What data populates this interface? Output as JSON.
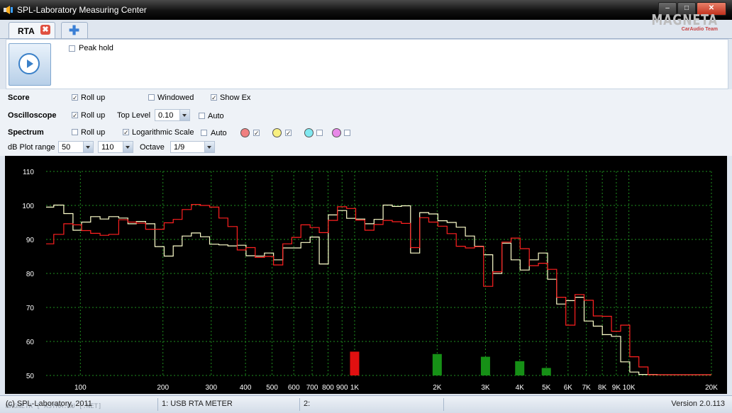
{
  "window": {
    "title": "SPL-Laboratory Measuring Center"
  },
  "logo": {
    "brand": "MAGNETA",
    "sub": "CarAudio Team"
  },
  "tabs": [
    {
      "label": "RTA",
      "close_icon": "close-icon"
    },
    {
      "add_icon": "plus-icon"
    }
  ],
  "panel": {
    "peak_hold_label": "Peak hold",
    "peak_hold_checked": false
  },
  "score": {
    "label": "Score",
    "rollup_label": "Roll up",
    "rollup_checked": true,
    "windowed_label": "Windowed",
    "windowed_checked": false,
    "showex_label": "Show Ex",
    "showex_checked": true
  },
  "oscilloscope": {
    "label": "Oscilloscope",
    "rollup_label": "Roll up",
    "rollup_checked": true,
    "toplevel_label": "Top Level",
    "toplevel_value": "0.10",
    "auto_label": "Auto",
    "auto_checked": false
  },
  "spectrum": {
    "label": "Spectrum",
    "rollup_label": "Roll up",
    "rollup_checked": false,
    "log_label": "Logarithmic Scale",
    "log_checked": true,
    "auto_label": "Auto",
    "auto_checked": false,
    "channels": [
      {
        "color": "#f08080",
        "checked": true
      },
      {
        "color": "#f8f080",
        "checked": true
      },
      {
        "color": "#80e8f0",
        "checked": false
      },
      {
        "color": "#e888e8",
        "checked": false
      }
    ],
    "range_label": "dB Plot range",
    "range_min": "50",
    "range_max": "110",
    "octave_label": "Octave",
    "octave_value": "1/9"
  },
  "chart_data": {
    "type": "line",
    "log_x": true,
    "xlim": [
      75,
      20000
    ],
    "ylim": [
      50,
      110
    ],
    "yticks": [
      50,
      60,
      70,
      80,
      90,
      100,
      110
    ],
    "xticks": [
      {
        "v": 100,
        "label": "100"
      },
      {
        "v": 200,
        "label": "200"
      },
      {
        "v": 300,
        "label": "300"
      },
      {
        "v": 400,
        "label": "400"
      },
      {
        "v": 500,
        "label": "500"
      },
      {
        "v": 600,
        "label": "600"
      },
      {
        "v": 700,
        "label": "700"
      },
      {
        "v": 800,
        "label": "800"
      },
      {
        "v": 900,
        "label": "900"
      },
      {
        "v": 1000,
        "label": "1K"
      },
      {
        "v": 2000,
        "label": "2K"
      },
      {
        "v": 3000,
        "label": "3K"
      },
      {
        "v": 4000,
        "label": "4K"
      },
      {
        "v": 5000,
        "label": "5K"
      },
      {
        "v": 6000,
        "label": "6K"
      },
      {
        "v": 7000,
        "label": "7K"
      },
      {
        "v": 8000,
        "label": "8K"
      },
      {
        "v": 9000,
        "label": "9K"
      },
      {
        "v": 10000,
        "label": "10K"
      },
      {
        "v": 20000,
        "label": "20K"
      }
    ],
    "grid": true,
    "bands": [
      75,
      80,
      87,
      94,
      101,
      109,
      118,
      127,
      138,
      149,
      160,
      173,
      187,
      202,
      218,
      235,
      254,
      274,
      296,
      320,
      345,
      373,
      402,
      434,
      469,
      506,
      547,
      590,
      637,
      688,
      743,
      802,
      866,
      935,
      1009,
      1090,
      1177,
      1270,
      1372,
      1481,
      1599,
      1727,
      1864,
      2013,
      2173,
      2347,
      2534,
      2736,
      2954,
      3189,
      3443,
      3718,
      4014,
      4334,
      4680,
      5052,
      5455,
      5890,
      6360,
      6866,
      7414,
      8004,
      8642,
      9331,
      10075,
      10877,
      11744,
      12680,
      13691,
      14782,
      15960,
      17232,
      18605,
      20000
    ],
    "series": [
      {
        "color": "#ffffcc",
        "values": [
          99.5,
          100.1,
          97.6,
          92.7,
          95.1,
          96.7,
          96.0,
          96.7,
          96.3,
          94.6,
          95.3,
          94.6,
          87.9,
          85.1,
          88.1,
          91.0,
          91.9,
          90.8,
          88.6,
          88.4,
          88.1,
          88.3,
          85.2,
          85.1,
          86.0,
          84.0,
          87.5,
          87.5,
          89.1,
          90.7,
          82.8,
          97.2,
          98.5,
          96.2,
          96.0,
          94.6,
          95.9,
          100.1,
          99.7,
          99.9,
          86.0,
          97.9,
          97.5,
          95.5,
          95.0,
          93.6,
          91.0,
          88.0,
          85.5,
          80.0,
          88.9,
          84.0,
          81.0,
          84.0,
          86.0,
          78.3,
          71.0,
          72.0,
          73.0,
          66.0,
          64.5,
          62.0,
          61.5,
          54.0,
          51.0,
          50.3,
          50.3,
          50.2,
          50.2,
          50.2,
          50.2,
          50.2,
          50.2
        ]
      },
      {
        "color": "#ff2020",
        "values": [
          88.7,
          91.5,
          94.6,
          94.3,
          92.6,
          91.8,
          91.2,
          91.5,
          95.8,
          95.1,
          94.8,
          93.0,
          93.0,
          94.9,
          95.9,
          98.8,
          100.3,
          100.0,
          99.5,
          96.3,
          93.8,
          86.9,
          87.6,
          84.7,
          85.0,
          82.5,
          88.7,
          90.6,
          94.3,
          93.5,
          92.0,
          95.6,
          99.6,
          99.1,
          95.7,
          92.7,
          94.4,
          95.6,
          95.2,
          94.7,
          87.6,
          96.4,
          95.1,
          93.9,
          91.7,
          88.0,
          87.5,
          87.9,
          76.2,
          80.5,
          89.2,
          90.4,
          87.3,
          82.3,
          83.0,
          81.2,
          73.0,
          64.8,
          73.8,
          72.1,
          67.5,
          67.4,
          63.0,
          64.8,
          55.5,
          52.5,
          50.2,
          50.2,
          50.2,
          50.2,
          50.2,
          50.2,
          50.2
        ]
      }
    ],
    "indicator_bars": [
      {
        "freq": 1000,
        "value": 57.0,
        "color": "#e01010"
      },
      {
        "freq": 2000,
        "value": 56.3,
        "color": "#169016"
      },
      {
        "freq": 3000,
        "value": 55.5,
        "color": "#169016"
      },
      {
        "freq": 4000,
        "value": 54.2,
        "color": "#169016"
      },
      {
        "freq": 5000,
        "value": 52.2,
        "color": "#169016"
      }
    ]
  },
  "status": {
    "copyright": "(c) SPL-Laboratory, 2011",
    "watermark": "MAGNETA [ ASTRA.RU [.NET]",
    "device1": "1: USB RTA METER",
    "device2": "2:",
    "version": "Version 2.0.113"
  }
}
